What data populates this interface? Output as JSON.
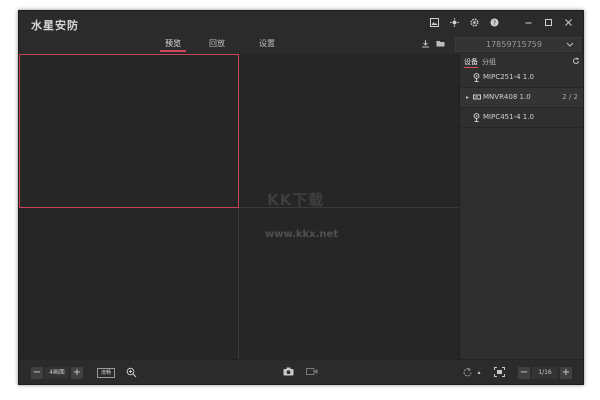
{
  "window": {
    "title": "水星安防"
  },
  "title_bar": {
    "icons": [
      "image-icon",
      "brightness-icon",
      "gear-icon",
      "help-icon"
    ],
    "controls": [
      "minimize-icon",
      "maximize-icon",
      "close-icon"
    ]
  },
  "nav": {
    "tabs": [
      {
        "label": "预览",
        "active": true
      },
      {
        "label": "回放",
        "active": false
      },
      {
        "label": "设置",
        "active": false
      }
    ],
    "download_icon": "download-icon",
    "folder_icon": "folder-icon",
    "account": "17859715759"
  },
  "panel": {
    "tabs": [
      {
        "label": "设备",
        "active": true
      },
      {
        "label": "分组",
        "active": false
      }
    ],
    "devices": [
      {
        "name": "MIPC251-4 1.0",
        "icon": "camera-icon",
        "expandable": false,
        "count": ""
      },
      {
        "name": "MNVR408 1.0",
        "icon": "nvr-icon",
        "expandable": true,
        "count": "2 / 2"
      },
      {
        "name": "MIPC451-4 1.0",
        "icon": "camera-icon",
        "expandable": false,
        "count": ""
      }
    ]
  },
  "bottom": {
    "layout_label": "4画面",
    "stream_label": "流畅",
    "page_label": "1/16"
  },
  "watermark": {
    "logo": "KK下载",
    "url": "www.kkx.net"
  },
  "colors": {
    "accent": "#d1495b",
    "background": "#2b2b2b",
    "grid": "#262626"
  }
}
